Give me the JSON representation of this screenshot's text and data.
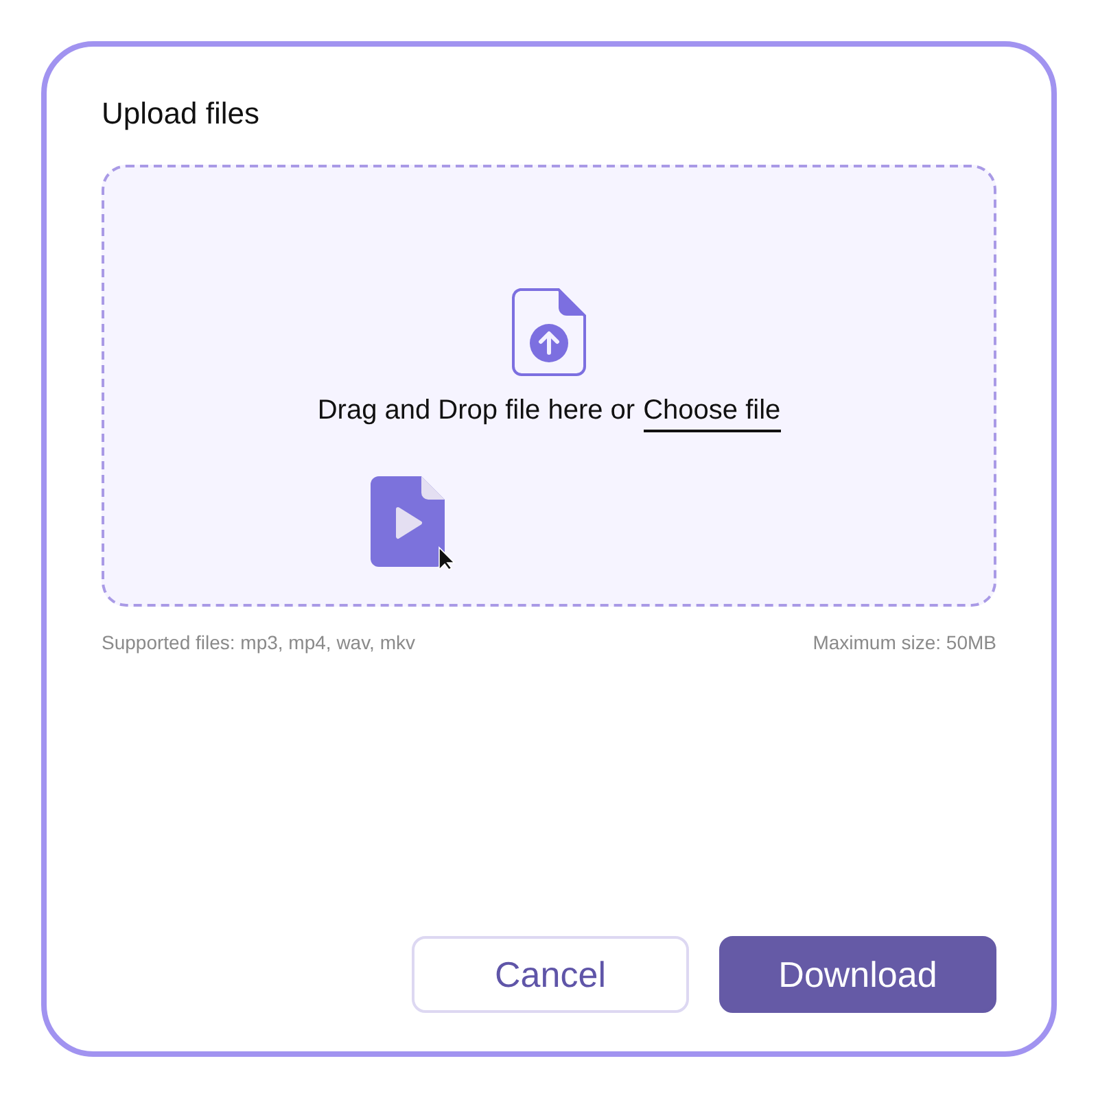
{
  "dialog": {
    "title": "Upload files"
  },
  "dropzone": {
    "prompt": "Drag and Drop file here or",
    "link": "Choose file",
    "dragging": true
  },
  "notes": {
    "supported": "Supported files: mp3, mp4, wav, mkv",
    "max_size": "Maximum size: 50MB"
  },
  "buttons": [
    {
      "label": "Cancel",
      "kind": "secondary"
    },
    {
      "label": "Download",
      "kind": "primary"
    }
  ]
}
